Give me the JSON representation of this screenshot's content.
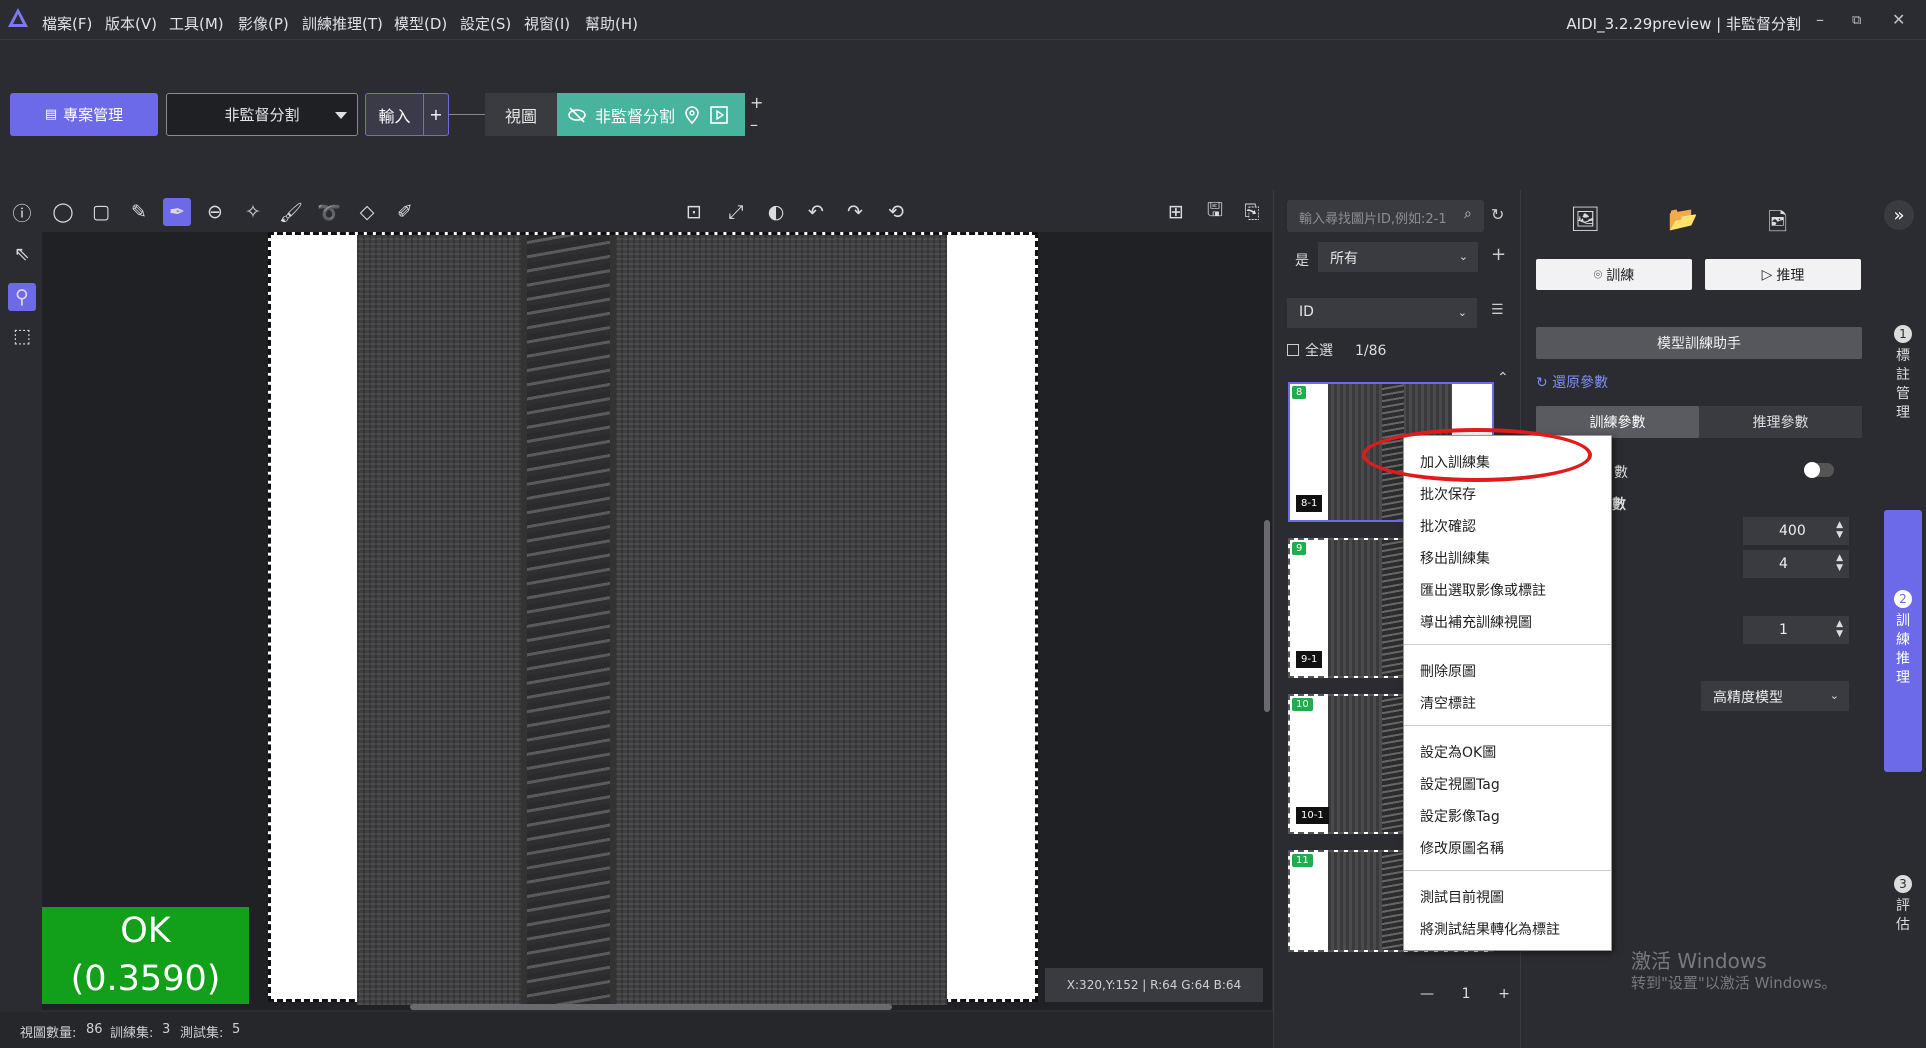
{
  "menu": [
    "檔案(F)",
    "版本(V)",
    "工具(M)",
    "影像(P)",
    "訓練推理(T)",
    "模型(D)",
    "設定(S)",
    "視窗(I)",
    "幫助(H)"
  ],
  "window_title": "AIDI_3.2.29preview | 非監督分割",
  "window_controls": {
    "minimize": "–",
    "restore": "⧉",
    "close": "✕"
  },
  "topbar": {
    "project_button": "專案管理",
    "mode_select": "非監督分割",
    "input_tab": "輸入",
    "add_input": "+",
    "view_button": "視圖",
    "module_name": "非監督分割",
    "plus": "+",
    "minus": "–"
  },
  "canvas": {
    "result_label": "OK",
    "result_score": "(0.3590)",
    "coords": "X:320,Y:152 | R:64 G:64 B:64"
  },
  "status": {
    "view_count_label": "視圖數量:",
    "view_count": "86",
    "train_label": "訓練集:",
    "train_count": "3",
    "test_label": "測試集:",
    "test_count": "5"
  },
  "mid": {
    "search_placeholder": "輸入尋找圖片ID,例如:2-1",
    "filter_label": "是",
    "filter_value": "所有",
    "sort_value": "ID",
    "select_all": "全選",
    "page_count": "1/86",
    "thumbs": [
      {
        "tag": "8",
        "label": "8-1"
      },
      {
        "tag": "9",
        "label": "9-1"
      },
      {
        "tag": "10",
        "label": "10-1"
      },
      {
        "tag": "11",
        "label": ""
      }
    ],
    "page_number": "1"
  },
  "context_menu": [
    "加入訓練集",
    "批次保存",
    "批次確認",
    "移出訓練集",
    "匯出選取影像或標註",
    "導出補充訓練視圖",
    "刪除原圖",
    "清空標註",
    "設定為OK圖",
    "設定視圖Tag",
    "設定影像Tag",
    "修改原圖名稱",
    "測試目前視圖",
    "將測試結果轉化為標註"
  ],
  "right": {
    "train_button": "訓練",
    "infer_button": "推理",
    "helper_button": "模型訓練助手",
    "restore_params": "還原參數",
    "tab_train": "訓練參數",
    "tab_infer": "推理參數",
    "param_partial_1": "數",
    "param_partial_2": "數",
    "spin1": "400",
    "spin2": "4",
    "spin3": "1",
    "model_select": "高精度模型"
  },
  "sidenav": [
    {
      "num": "1",
      "label": "標註管理"
    },
    {
      "num": "2",
      "label": "訓練推理"
    },
    {
      "num": "3",
      "label": "評估"
    }
  ],
  "watermark": {
    "line1": "激活 Windows",
    "line2": "转到\"设置\"以激活 Windows。"
  },
  "colors": {
    "accent": "#6d6aea",
    "teal": "#48b49e",
    "ok_green": "#12a01a",
    "highlight_red": "#e01b1b"
  }
}
